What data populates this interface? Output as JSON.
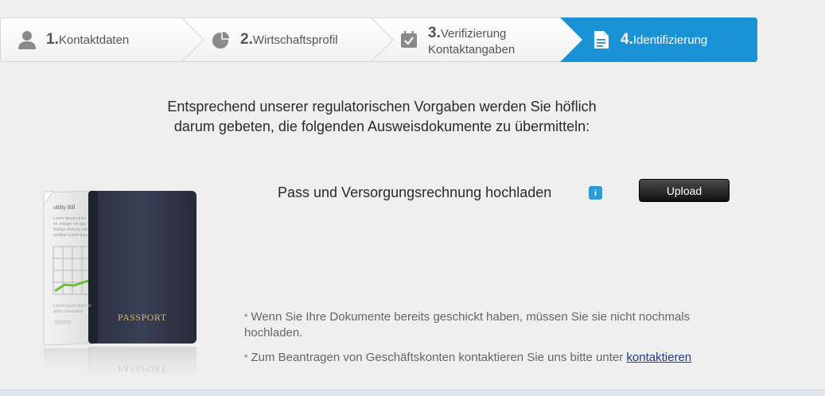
{
  "stepper": {
    "steps": [
      {
        "num": "1.",
        "label": "Kontaktdaten",
        "icon": "user-icon"
      },
      {
        "num": "2.",
        "label": "Wirtschaftsprofil",
        "icon": "pie-chart-icon"
      },
      {
        "num": "3.",
        "label": "Verifizierung",
        "label2": "Kontaktangaben",
        "icon": "calendar-check-icon"
      },
      {
        "num": "4.",
        "label": "Identifizierung",
        "icon": "document-icon"
      }
    ],
    "active_color": "#1a93d6"
  },
  "intro": {
    "line1": "Entsprechend unserer regulatorischen Vorgaben werden Sie höflich",
    "line2": "darum gebeten, die folgenden Ausweisdokumente zu übermitteln:"
  },
  "upload": {
    "label": "Pass und Versorgungsrechnung hochladen",
    "button": "Upload",
    "info_icon_glyph": "i"
  },
  "illustration": {
    "bill_title": "utility Bill",
    "bill_lorem": [
      "Lorem ipsum dolor",
      "sit. Integer vel luja",
      "Nullam rhoncus pla",
      "porttitor Lorem ipsu"
    ],
    "bill_footer_lorem": [
      "Lorem ipsum dolor sit",
      "amet consectetur"
    ],
    "bill_logo": "etoro",
    "passport_text": "PASSPORT"
  },
  "notes": {
    "note1_star": "*",
    "note1": "Wenn Sie Ihre Dokumente bereits geschickt haben, müssen Sie sie nicht nochmals hochladen.",
    "note2_star": "*",
    "note2": "Zum Beantragen von Geschäftskonten kontaktieren Sie uns bitte unter",
    "note2_link": "kontaktieren"
  }
}
